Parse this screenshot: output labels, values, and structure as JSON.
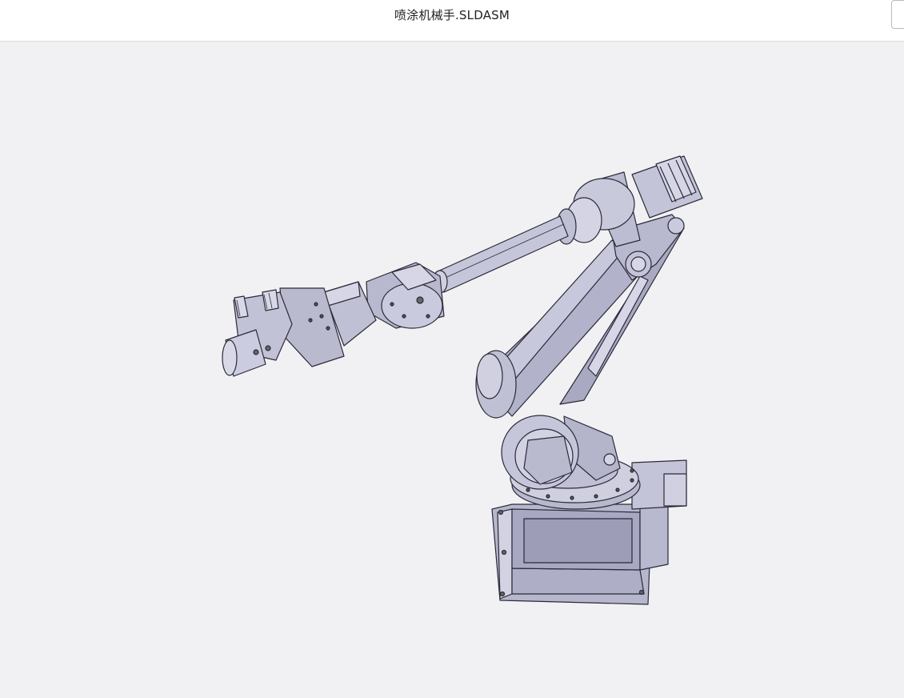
{
  "header": {
    "title": "喷涂机械手.SLDASM"
  },
  "viewport": {
    "model_name": "robot-arm-model",
    "part_fill": "#c4c4d8",
    "part_dark": "#9a9ab4",
    "outline": "#2a2a3a",
    "background": "#f1f0f2"
  }
}
